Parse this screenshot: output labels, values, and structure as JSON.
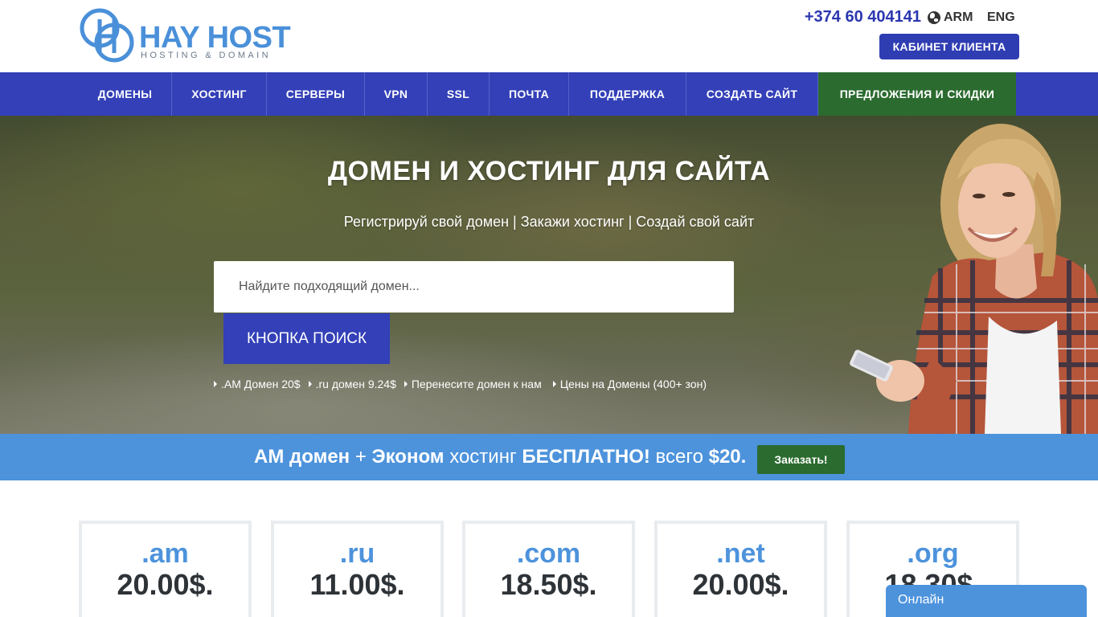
{
  "header": {
    "logo_name": "HAY HOST",
    "logo_sub": "HOSTING & DOMAIN",
    "phone": "+374 60 404141",
    "lang_arm": "ARM",
    "lang_eng": "ENG",
    "cabinet_label": "КАБИНЕТ КЛИЕНТА"
  },
  "nav": {
    "items": [
      {
        "label": "ДОМЕНЫ"
      },
      {
        "label": "ХОСТИНГ"
      },
      {
        "label": "СЕРВЕРЫ"
      },
      {
        "label": "VPN"
      },
      {
        "label": "SSL"
      },
      {
        "label": "ПОЧТА"
      },
      {
        "label": "ПОДДЕРЖКА"
      },
      {
        "label": "СОЗДАТЬ САЙТ"
      },
      {
        "label": "ПРЕДЛОЖЕНИЯ И СКИДКИ"
      }
    ]
  },
  "hero": {
    "title": "ДОМЕН И ХОСТИНГ ДЛЯ САЙТА",
    "subtitle": "Регистрируй свой домен | Закажи хостинг | Создай свой сайт",
    "search_placeholder": "Найдите подходящий домен...",
    "search_button": "КНОПКА ПОИСК",
    "quick_links": [
      ".AM Домен 20$",
      ".ru домен 9.24$",
      "Перенесите домен к нам",
      "Цены на Домены (400+ зон)"
    ]
  },
  "promo": {
    "part1": "AM домен",
    "part2": " + ",
    "part3": "Эконом",
    "part4": " хостинг ",
    "part5": "БЕСПЛАТНО!",
    "part6": " всего ",
    "part7": "$20.",
    "order_label": "Заказать!"
  },
  "domains": [
    {
      "tld": ".am",
      "price": "20.00$."
    },
    {
      "tld": ".ru",
      "price": "11.00$."
    },
    {
      "tld": ".com",
      "price": "18.50$."
    },
    {
      "tld": ".net",
      "price": "20.00$."
    },
    {
      "tld": ".org",
      "price": "18.30$."
    }
  ],
  "chat": {
    "label": "Онлайн"
  },
  "colors": {
    "brand_blue": "#3340b8",
    "light_blue": "#4d93dc",
    "green": "#2b6b2f"
  }
}
